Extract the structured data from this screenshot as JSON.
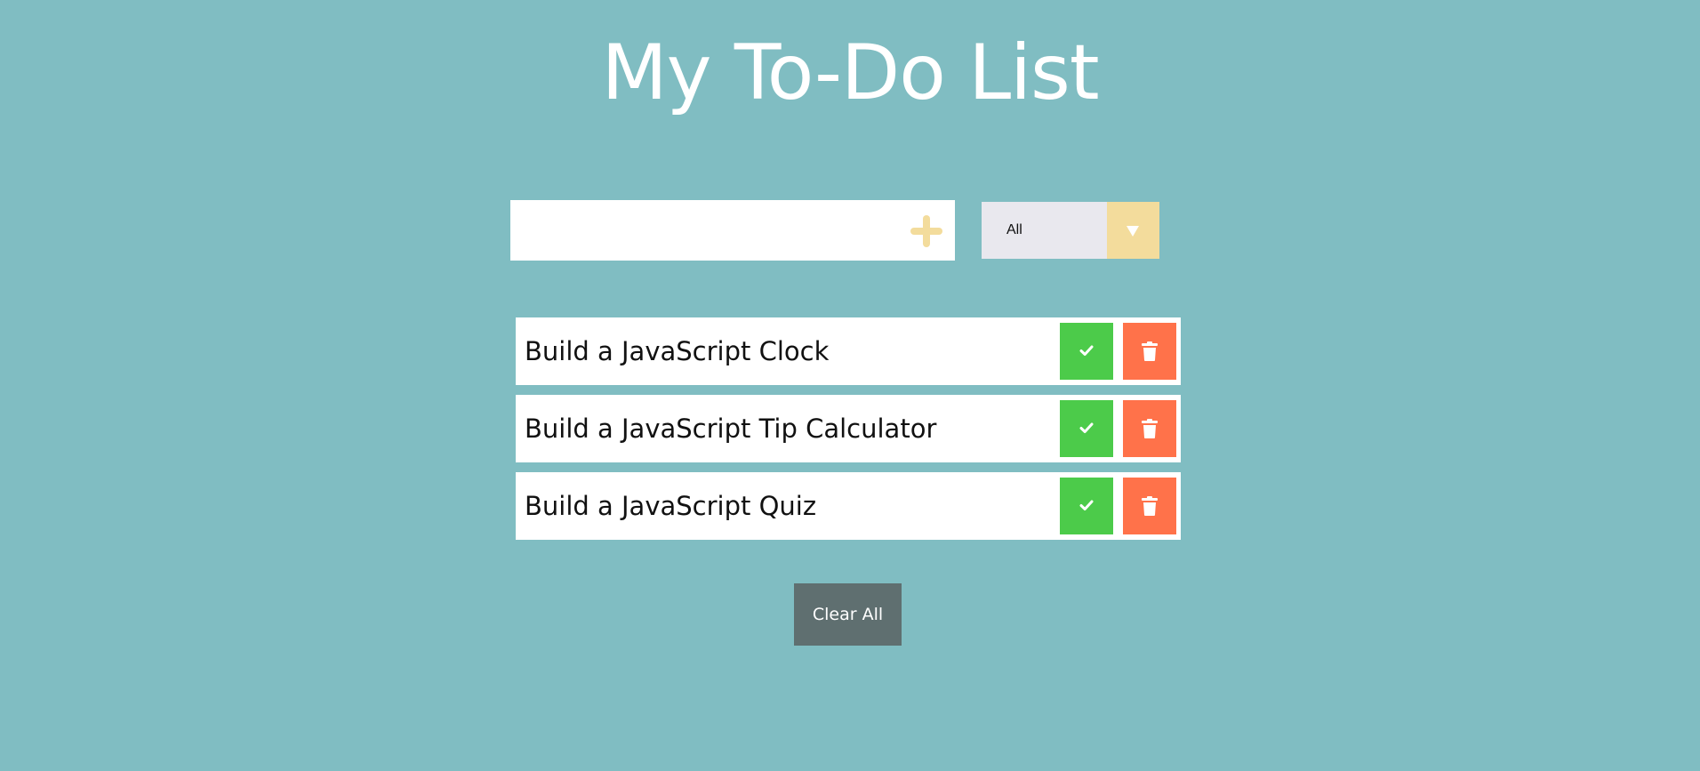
{
  "header": {
    "title": "My To-Do List"
  },
  "add_form": {
    "input_value": "",
    "input_placeholder": "",
    "add_icon": "plus-icon"
  },
  "filter": {
    "selected": "All",
    "arrow_icon": "caret-down-icon"
  },
  "todos": [
    {
      "text": "Build a JavaScript Clock",
      "complete_icon": "check-icon",
      "delete_icon": "trash-icon"
    },
    {
      "text": "Build a JavaScript Tip Calculator",
      "complete_icon": "check-icon",
      "delete_icon": "trash-icon"
    },
    {
      "text": "Build a JavaScript Quiz",
      "complete_icon": "check-icon",
      "delete_icon": "trash-icon"
    }
  ],
  "footer": {
    "clear_all_label": "Clear All"
  },
  "colors": {
    "background": "#80bdc2",
    "accent_yellow": "#f3dc9c",
    "complete_green": "#4ccb4a",
    "delete_orange": "#ff724a",
    "clear_button": "#5f6f70",
    "select_bg": "#e9e8ee"
  }
}
